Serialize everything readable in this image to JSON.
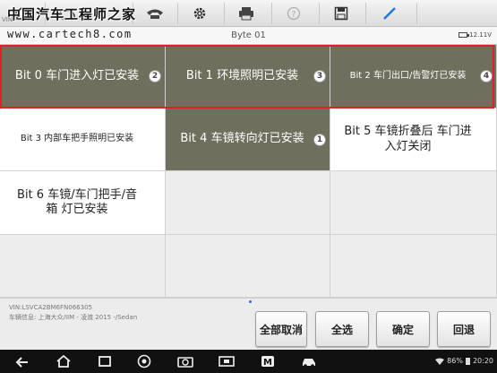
{
  "watermark": {
    "site_name": "中国汽车工程师之家",
    "url": "www.cartech8.com"
  },
  "top_vin_fragment": "VIN",
  "toolbar": {
    "icons": [
      "home-icon",
      "car-icon",
      "phone-icon",
      "gear-icon",
      "printer-icon",
      "help-icon",
      "save-icon",
      "pen-icon"
    ]
  },
  "header": {
    "title": "Byte 01",
    "battery": "12.11V"
  },
  "cells": [
    {
      "label": "Bit 0 车门进入灯已安装",
      "badge": "2",
      "state": "selected"
    },
    {
      "label": "Bit 1 环境照明已安装",
      "badge": "3",
      "state": "selected"
    },
    {
      "label": "Bit 2 车门出口/告警灯已安装",
      "badge": "4",
      "state": "selected"
    },
    {
      "label": "Bit 3 内部车把手照明已安装",
      "badge": "",
      "state": "unselected"
    },
    {
      "label": "Bit 4 车镜转向灯已安装",
      "badge": "1",
      "state": "selected"
    },
    {
      "label": "Bit 5 车镜折叠后 车门进入灯关闭",
      "badge": "",
      "state": "unselected"
    },
    {
      "label": "Bit 6 车镜/车门把手/音箱 灯已安装",
      "badge": "",
      "state": "unselected"
    }
  ],
  "footer": {
    "vin": "VIN:LSVCA2BM6FN066305",
    "vehicle": "车辆信息: 上海大众/IIM - 凌渡 2015 -/Sedan"
  },
  "actions": {
    "deselect_all": "全部取消",
    "select_all": "全选",
    "confirm": "确定",
    "back": "回退"
  },
  "status_bar": {
    "battery": "86%",
    "time": "20:20"
  },
  "colors": {
    "selected": "#6e6f5d",
    "highlight": "#e31e24",
    "nav_bg": "#111111"
  }
}
